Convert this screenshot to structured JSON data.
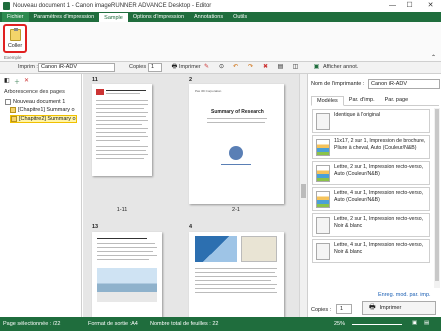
{
  "window": {
    "title": "Nouveau document 1 - Canon imageRUNNER ADVANCE Desktop - Editor",
    "minimize": "—",
    "maximize": "☐",
    "close": "✕"
  },
  "tabs": [
    {
      "label": "Fichier"
    },
    {
      "label": "Paramètres d'impression"
    },
    {
      "label": "Sample"
    },
    {
      "label": "Options d'impression"
    },
    {
      "label": "Annotations"
    },
    {
      "label": "Outils"
    }
  ],
  "ribbon": {
    "paste_label": "Coller",
    "group_label": "Exemple"
  },
  "toolbar": {
    "printer_label": "Imprim :",
    "printer_value": "Canon iR-ADV",
    "copies_label": "Copies :",
    "copies_value": "1",
    "print_label": "Imprimer",
    "annot_label": "Afficher annot."
  },
  "left": {
    "title": "Arborescence des pages",
    "items": [
      {
        "label": "Nouveau document 1"
      },
      {
        "label": "[Chapitre1] Summary o"
      },
      {
        "label": "[Chapitre2] Summary o"
      }
    ]
  },
  "center": {
    "pages": [
      {
        "num": "11",
        "caption": "1-11"
      },
      {
        "num": "2",
        "caption": "2-1"
      },
      {
        "num": "13",
        "caption": ""
      },
      {
        "num": "4",
        "caption": ""
      }
    ],
    "thumb_title_a": "Summary of Research",
    "thumb_sub_a": "Pax 3D Corporation"
  },
  "right": {
    "printer_label": "Nom de l'imprimante :",
    "printer_value": "Canon iR-ADV",
    "tabs": [
      {
        "label": "Modèles"
      },
      {
        "label": "Par. d'imp."
      },
      {
        "label": "Par. page"
      }
    ],
    "settings": [
      {
        "label": "Identique à l'original"
      },
      {
        "label": "11x17, 2 sur 1, Impression de brochure, Pliure à cheval, Auto (Couleur/N&B)"
      },
      {
        "label": "Lettre, 2 sur 1, Impression recto-verso, Auto (Couleur/N&B)"
      },
      {
        "label": "Lettre, 4 sur 1, Impression recto-verso, Auto (Couleur/N&B)"
      },
      {
        "label": "Lettre, 2 sur 1, Impression recto-verso, Noir & blanc"
      },
      {
        "label": "Lettre, 4 sur 1, Impression recto-verso, Noir & blanc"
      }
    ],
    "edit_link": "Enreg. mod. par. imp.",
    "copies_label": "Copies :",
    "copies_value": "1",
    "print_label": "Imprimer"
  },
  "status": {
    "selected": "Page sélectionnée : /22",
    "format": "Format de sortie :A4",
    "total": "Nombre total de feuilles : 22",
    "zoom": "25%"
  },
  "colors": {
    "brand": "#1f6d3d",
    "highlight": "#e02020",
    "selection": "#fff4a8"
  }
}
